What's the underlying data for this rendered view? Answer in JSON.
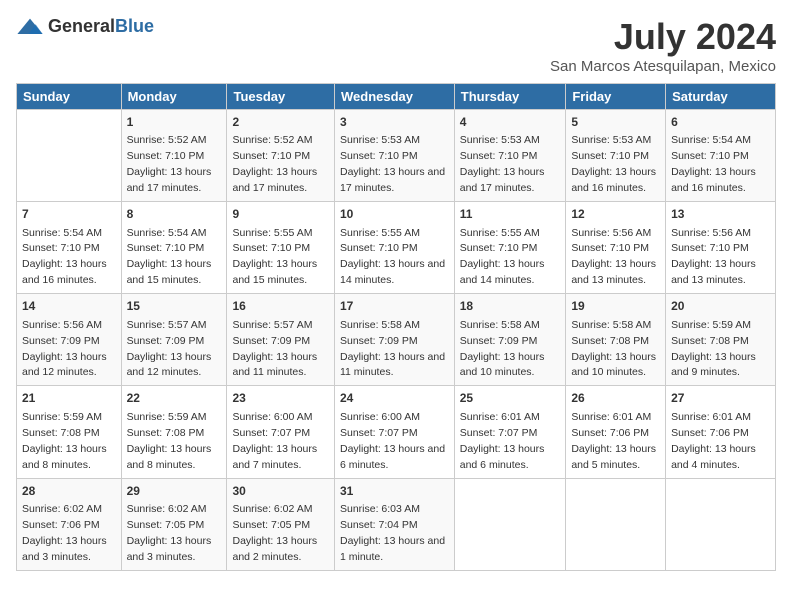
{
  "header": {
    "logo_general": "General",
    "logo_blue": "Blue",
    "title": "July 2024",
    "subtitle": "San Marcos Atesquilapan, Mexico"
  },
  "days_of_week": [
    "Sunday",
    "Monday",
    "Tuesday",
    "Wednesday",
    "Thursday",
    "Friday",
    "Saturday"
  ],
  "weeks": [
    [
      {
        "day": "",
        "sunrise": "",
        "sunset": "",
        "daylight": ""
      },
      {
        "day": "1",
        "sunrise": "Sunrise: 5:52 AM",
        "sunset": "Sunset: 7:10 PM",
        "daylight": "Daylight: 13 hours and 17 minutes."
      },
      {
        "day": "2",
        "sunrise": "Sunrise: 5:52 AM",
        "sunset": "Sunset: 7:10 PM",
        "daylight": "Daylight: 13 hours and 17 minutes."
      },
      {
        "day": "3",
        "sunrise": "Sunrise: 5:53 AM",
        "sunset": "Sunset: 7:10 PM",
        "daylight": "Daylight: 13 hours and 17 minutes."
      },
      {
        "day": "4",
        "sunrise": "Sunrise: 5:53 AM",
        "sunset": "Sunset: 7:10 PM",
        "daylight": "Daylight: 13 hours and 17 minutes."
      },
      {
        "day": "5",
        "sunrise": "Sunrise: 5:53 AM",
        "sunset": "Sunset: 7:10 PM",
        "daylight": "Daylight: 13 hours and 16 minutes."
      },
      {
        "day": "6",
        "sunrise": "Sunrise: 5:54 AM",
        "sunset": "Sunset: 7:10 PM",
        "daylight": "Daylight: 13 hours and 16 minutes."
      }
    ],
    [
      {
        "day": "7",
        "sunrise": "Sunrise: 5:54 AM",
        "sunset": "Sunset: 7:10 PM",
        "daylight": "Daylight: 13 hours and 16 minutes."
      },
      {
        "day": "8",
        "sunrise": "Sunrise: 5:54 AM",
        "sunset": "Sunset: 7:10 PM",
        "daylight": "Daylight: 13 hours and 15 minutes."
      },
      {
        "day": "9",
        "sunrise": "Sunrise: 5:55 AM",
        "sunset": "Sunset: 7:10 PM",
        "daylight": "Daylight: 13 hours and 15 minutes."
      },
      {
        "day": "10",
        "sunrise": "Sunrise: 5:55 AM",
        "sunset": "Sunset: 7:10 PM",
        "daylight": "Daylight: 13 hours and 14 minutes."
      },
      {
        "day": "11",
        "sunrise": "Sunrise: 5:55 AM",
        "sunset": "Sunset: 7:10 PM",
        "daylight": "Daylight: 13 hours and 14 minutes."
      },
      {
        "day": "12",
        "sunrise": "Sunrise: 5:56 AM",
        "sunset": "Sunset: 7:10 PM",
        "daylight": "Daylight: 13 hours and 13 minutes."
      },
      {
        "day": "13",
        "sunrise": "Sunrise: 5:56 AM",
        "sunset": "Sunset: 7:10 PM",
        "daylight": "Daylight: 13 hours and 13 minutes."
      }
    ],
    [
      {
        "day": "14",
        "sunrise": "Sunrise: 5:56 AM",
        "sunset": "Sunset: 7:09 PM",
        "daylight": "Daylight: 13 hours and 12 minutes."
      },
      {
        "day": "15",
        "sunrise": "Sunrise: 5:57 AM",
        "sunset": "Sunset: 7:09 PM",
        "daylight": "Daylight: 13 hours and 12 minutes."
      },
      {
        "day": "16",
        "sunrise": "Sunrise: 5:57 AM",
        "sunset": "Sunset: 7:09 PM",
        "daylight": "Daylight: 13 hours and 11 minutes."
      },
      {
        "day": "17",
        "sunrise": "Sunrise: 5:58 AM",
        "sunset": "Sunset: 7:09 PM",
        "daylight": "Daylight: 13 hours and 11 minutes."
      },
      {
        "day": "18",
        "sunrise": "Sunrise: 5:58 AM",
        "sunset": "Sunset: 7:09 PM",
        "daylight": "Daylight: 13 hours and 10 minutes."
      },
      {
        "day": "19",
        "sunrise": "Sunrise: 5:58 AM",
        "sunset": "Sunset: 7:08 PM",
        "daylight": "Daylight: 13 hours and 10 minutes."
      },
      {
        "day": "20",
        "sunrise": "Sunrise: 5:59 AM",
        "sunset": "Sunset: 7:08 PM",
        "daylight": "Daylight: 13 hours and 9 minutes."
      }
    ],
    [
      {
        "day": "21",
        "sunrise": "Sunrise: 5:59 AM",
        "sunset": "Sunset: 7:08 PM",
        "daylight": "Daylight: 13 hours and 8 minutes."
      },
      {
        "day": "22",
        "sunrise": "Sunrise: 5:59 AM",
        "sunset": "Sunset: 7:08 PM",
        "daylight": "Daylight: 13 hours and 8 minutes."
      },
      {
        "day": "23",
        "sunrise": "Sunrise: 6:00 AM",
        "sunset": "Sunset: 7:07 PM",
        "daylight": "Daylight: 13 hours and 7 minutes."
      },
      {
        "day": "24",
        "sunrise": "Sunrise: 6:00 AM",
        "sunset": "Sunset: 7:07 PM",
        "daylight": "Daylight: 13 hours and 6 minutes."
      },
      {
        "day": "25",
        "sunrise": "Sunrise: 6:01 AM",
        "sunset": "Sunset: 7:07 PM",
        "daylight": "Daylight: 13 hours and 6 minutes."
      },
      {
        "day": "26",
        "sunrise": "Sunrise: 6:01 AM",
        "sunset": "Sunset: 7:06 PM",
        "daylight": "Daylight: 13 hours and 5 minutes."
      },
      {
        "day": "27",
        "sunrise": "Sunrise: 6:01 AM",
        "sunset": "Sunset: 7:06 PM",
        "daylight": "Daylight: 13 hours and 4 minutes."
      }
    ],
    [
      {
        "day": "28",
        "sunrise": "Sunrise: 6:02 AM",
        "sunset": "Sunset: 7:06 PM",
        "daylight": "Daylight: 13 hours and 3 minutes."
      },
      {
        "day": "29",
        "sunrise": "Sunrise: 6:02 AM",
        "sunset": "Sunset: 7:05 PM",
        "daylight": "Daylight: 13 hours and 3 minutes."
      },
      {
        "day": "30",
        "sunrise": "Sunrise: 6:02 AM",
        "sunset": "Sunset: 7:05 PM",
        "daylight": "Daylight: 13 hours and 2 minutes."
      },
      {
        "day": "31",
        "sunrise": "Sunrise: 6:03 AM",
        "sunset": "Sunset: 7:04 PM",
        "daylight": "Daylight: 13 hours and 1 minute."
      },
      {
        "day": "",
        "sunrise": "",
        "sunset": "",
        "daylight": ""
      },
      {
        "day": "",
        "sunrise": "",
        "sunset": "",
        "daylight": ""
      },
      {
        "day": "",
        "sunrise": "",
        "sunset": "",
        "daylight": ""
      }
    ]
  ]
}
